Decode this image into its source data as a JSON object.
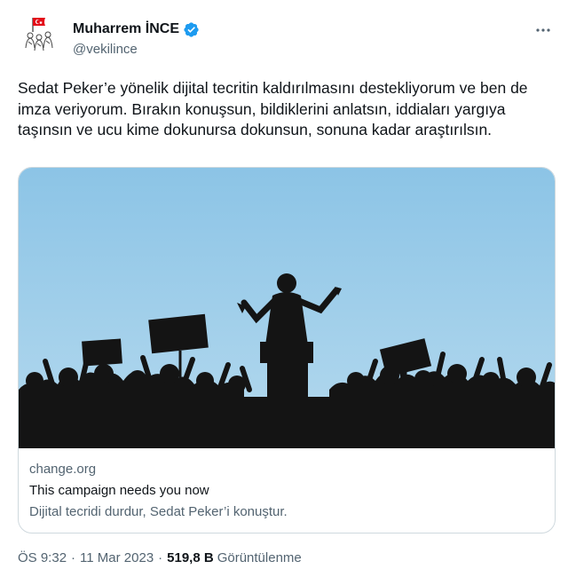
{
  "author": {
    "display_name": "Muharrem İNCE",
    "handle": "@vekilince",
    "verified": true,
    "avatar_icon": "flag-seal-icon"
  },
  "more_icon": "ellipsis-icon",
  "tweet": {
    "text": "Sedat Peker’e yönelik dijital tecritin kaldırılmasını destekliyorum ve ben de imza veriyorum. Bırakın konuşsun, bildiklerini anlatsın, iddiaları yargıya taşınsın ve ucu kime dokunursa dokunsun, sonuna kadar araştırılsın."
  },
  "card": {
    "domain": "change.org",
    "title": "This campaign needs you now",
    "description": "Dijital tecridi durdur, Sedat Peker’i konuştur.",
    "image": "crowd-speaker-silhouette"
  },
  "footer": {
    "time": "ÖS 9:32",
    "separator": "·",
    "date": "11 Mar 2023",
    "views_count": "519,8 B",
    "views_label": "Görüntülenme"
  },
  "colors": {
    "text": "#0f1419",
    "secondary": "#536471",
    "verified": "#1d9bf0",
    "border": "#cfd9de",
    "sky_top": "#8cc4e6",
    "sky_bottom": "#b4d9ee",
    "silhouette": "#141414"
  }
}
